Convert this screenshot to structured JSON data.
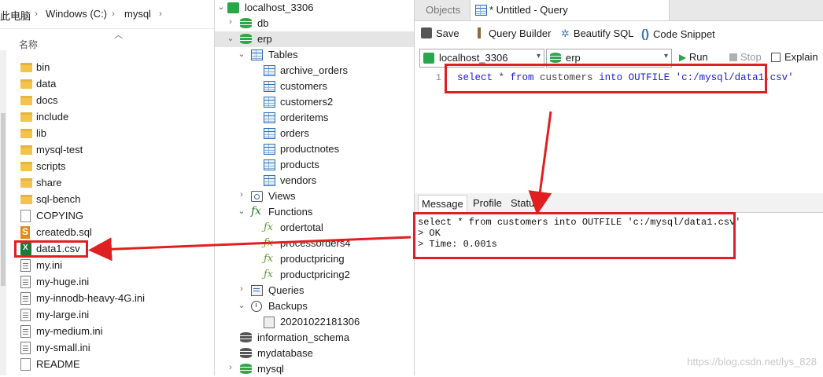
{
  "explorer": {
    "breadcrumb": [
      "此电脑",
      "Windows (C:)",
      "mysql"
    ],
    "column_header": "名称",
    "files": [
      {
        "name": "bin",
        "type": "folder"
      },
      {
        "name": "data",
        "type": "folder"
      },
      {
        "name": "docs",
        "type": "folder"
      },
      {
        "name": "include",
        "type": "folder"
      },
      {
        "name": "lib",
        "type": "folder"
      },
      {
        "name": "mysql-test",
        "type": "folder"
      },
      {
        "name": "scripts",
        "type": "folder"
      },
      {
        "name": "share",
        "type": "folder"
      },
      {
        "name": "sql-bench",
        "type": "folder"
      },
      {
        "name": "COPYING",
        "type": "doc"
      },
      {
        "name": "createdb.sql",
        "type": "sql"
      },
      {
        "name": "data1.csv",
        "type": "csv"
      },
      {
        "name": "my.ini",
        "type": "ini"
      },
      {
        "name": "my-huge.ini",
        "type": "ini"
      },
      {
        "name": "my-innodb-heavy-4G.ini",
        "type": "ini"
      },
      {
        "name": "my-large.ini",
        "type": "ini"
      },
      {
        "name": "my-medium.ini",
        "type": "ini"
      },
      {
        "name": "my-small.ini",
        "type": "ini"
      },
      {
        "name": "README",
        "type": "doc"
      }
    ]
  },
  "tree": {
    "connection": "localhost_3306",
    "databases": {
      "db": "db",
      "erp": "erp",
      "tables_label": "Tables",
      "tables": [
        "archive_orders",
        "customers",
        "customers2",
        "orderitems",
        "orders",
        "productnotes",
        "products",
        "vendors"
      ],
      "views_label": "Views",
      "functions_label": "Functions",
      "functions": [
        "ordertotal",
        "processorders4",
        "productpricing",
        "productpricing2"
      ],
      "queries_label": "Queries",
      "backups_label": "Backups",
      "backup_file": "20201022181306",
      "info_schema": "information_schema",
      "mydatabase": "mydatabase",
      "mysql": "mysql"
    }
  },
  "query": {
    "tabs": {
      "objects": "Objects",
      "untitled": "* Untitled - Query"
    },
    "toolbar": {
      "save": "Save",
      "query_builder": "Query Builder",
      "beautify": "Beautify SQL",
      "snippet": "Code Snippet"
    },
    "connection_select": "localhost_3306",
    "database_select": "erp",
    "run": "Run",
    "stop": "Stop",
    "explain": "Explain",
    "line_number": "1",
    "sql": {
      "select": "select",
      "star": " * ",
      "from": "from",
      "table": " customers ",
      "into": "into",
      "outfile": " OUTFILE ",
      "path": "'c:/mysql/data1.csv'"
    },
    "result_tabs": {
      "message": "Message",
      "profile": "Profile",
      "status": "Status"
    },
    "message_lines": [
      "select * from customers into OUTFILE 'c:/mysql/data1.csv'",
      "> OK",
      "> Time: 0.001s"
    ]
  },
  "watermark": "https://blog.csdn.net/lys_828",
  "colors": {
    "highlight": "#e02020",
    "connection_green": "#2aa64a",
    "keyword_blue": "#1b1bd6"
  }
}
